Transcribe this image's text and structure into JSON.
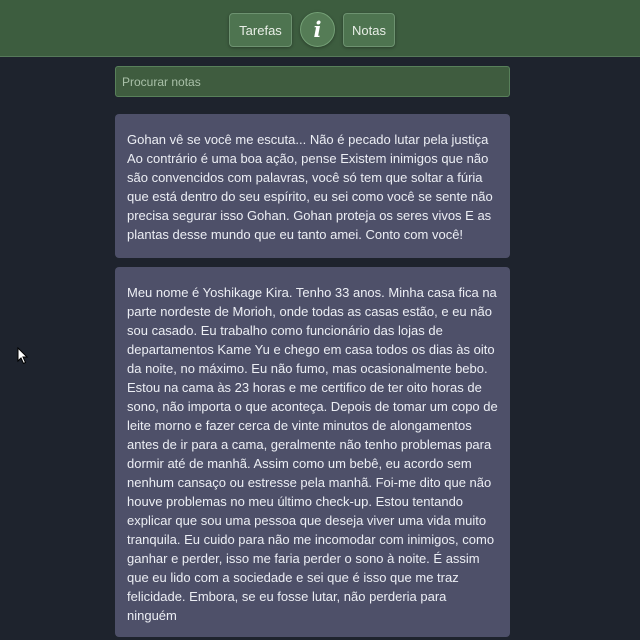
{
  "nav": {
    "tasks_label": "Tarefas",
    "info_label": "i",
    "notes_label": "Notas"
  },
  "search": {
    "placeholder": "Procurar notas",
    "value": ""
  },
  "notes": [
    {
      "text": "Gohan vê se você me escuta... Não é pecado lutar pela justiça Ao contrário é uma boa ação, pense Existem inimigos que não são convencidos com palavras, você só tem que soltar a fúria que está dentro do seu espírito, eu sei como você se sente não precisa segurar isso Gohan. Gohan proteja os seres vivos E as plantas desse mundo que eu tanto amei. Conto com você!"
    },
    {
      "text": "Meu nome é Yoshikage Kira. Tenho 33 anos. Minha casa fica na parte nordeste de Morioh, onde todas as casas estão, e eu não sou casado. Eu trabalho como funcionário das lojas de departamentos Kame Yu e chego em casa todos os dias às oito da noite, no máximo. Eu não fumo, mas ocasionalmente bebo. Estou na cama às 23 horas e me certifico de ter oito horas de sono, não importa o que aconteça. Depois de tomar um copo de leite morno e fazer cerca de vinte minutos de alongamentos antes de ir para a cama, geralmente não tenho problemas para dormir até de manhã. Assim como um bebê, eu acordo sem nenhum cansaço ou estresse pela manhã. Foi-me dito que não houve problemas no meu último check-up. Estou tentando explicar que sou uma pessoa que deseja viver uma vida muito tranquila. Eu cuido para não me incomodar com inimigos, como ganhar e perder, isso me faria perder o sono à noite. É assim que eu lido com a sociedade e sei que é isso que me traz felicidade. Embora, se eu fosse lutar, não perderia para ninguém"
    }
  ],
  "icons": {
    "cursor": "arrow-cursor-icon"
  },
  "colors": {
    "background": "#1e232d",
    "header": "#3d5d3f",
    "button": "#4e7450",
    "note_card": "#4e5069",
    "search_bg": "#3f5c3f"
  }
}
